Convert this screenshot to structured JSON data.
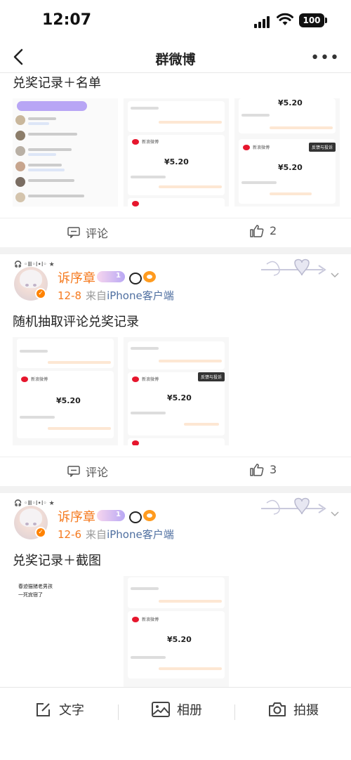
{
  "status_bar": {
    "time": "12:07",
    "battery": "100"
  },
  "nav": {
    "title": "群微博",
    "back_icon": "chevron-left-icon",
    "more_label": "•••"
  },
  "posts": [
    {
      "title": "兑奖记录＋名单",
      "comment_label": "评论",
      "like_count": "2",
      "thumbs": [
        {
          "kind": "chat"
        },
        {
          "kind": "receipt",
          "amount": "¥5.20",
          "brand": "新浪微博"
        },
        {
          "kind": "receipt",
          "amount": "¥5.20",
          "brand": "新浪微博",
          "tag": "反馈与投诉"
        }
      ]
    },
    {
      "headset_text": "🎧 ◦Ⅲ◦Ⅰ•Ⅰ◦ ★",
      "username": "诉序章",
      "date": "12-8",
      "source_prefix": "来自",
      "source_client": "iPhone客户端",
      "title": "随机抽取评论兑奖记录",
      "comment_label": "评论",
      "like_count": "3",
      "thumbs": [
        {
          "kind": "receipt",
          "amount": "¥5.20",
          "brand": "新浪微博"
        },
        {
          "kind": "receipt",
          "amount": "¥5.20",
          "brand": "新浪微博",
          "tag": "反馈与投诉"
        }
      ]
    },
    {
      "headset_text": "🎧 ◦Ⅲ◦Ⅰ•Ⅰ◦ ★",
      "username": "诉序章",
      "date": "12-6",
      "source_prefix": "来自",
      "source_client": "iPhone客户端",
      "title": "兑奖记录＋截图",
      "thumbs": [
        {
          "kind": "text-note",
          "lines": [
            "春迹猫猪老男孩",
            "一死宾宿了"
          ]
        },
        {
          "kind": "receipt",
          "amount": "¥5.20",
          "brand": "新浪微博"
        }
      ]
    }
  ],
  "toolbar": {
    "text_label": "文字",
    "album_label": "相册",
    "camera_label": "拍摄"
  },
  "colors": {
    "accent": "#f57a1f",
    "client_link": "#4f6fa0",
    "weibo_red": "#e6162d"
  }
}
